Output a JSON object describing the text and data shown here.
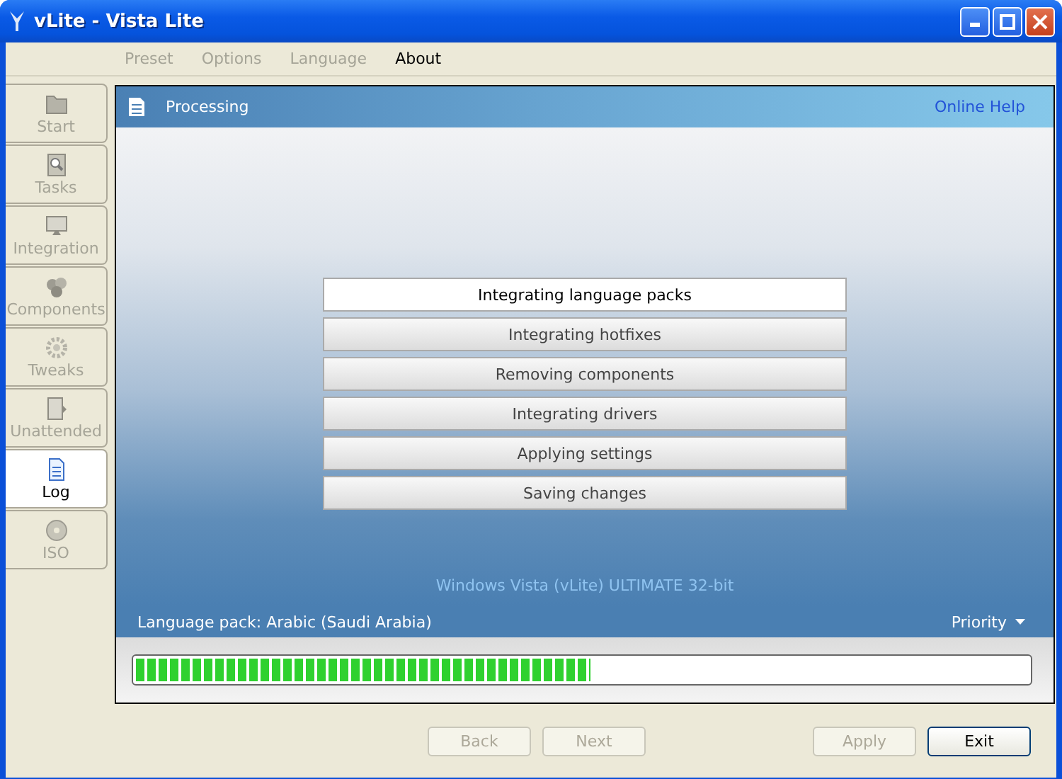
{
  "window": {
    "title": "vLite - Vista Lite"
  },
  "menu": [
    {
      "label": "Preset",
      "disabled": true
    },
    {
      "label": "Options",
      "disabled": true
    },
    {
      "label": "Language",
      "disabled": true
    },
    {
      "label": "About",
      "disabled": false
    }
  ],
  "sidebar": {
    "items": [
      {
        "label": "Start",
        "selected": false
      },
      {
        "label": "Tasks",
        "selected": false
      },
      {
        "label": "Integration",
        "selected": false
      },
      {
        "label": "Components",
        "selected": false
      },
      {
        "label": "Tweaks",
        "selected": false
      },
      {
        "label": "Unattended",
        "selected": false
      },
      {
        "label": "Log",
        "selected": true
      },
      {
        "label": "ISO",
        "selected": false
      }
    ]
  },
  "panel": {
    "title": "Processing",
    "help_link": "Online Help",
    "steps": [
      {
        "label": "Integrating language packs",
        "selected": true
      },
      {
        "label": "Integrating hotfixes",
        "selected": false
      },
      {
        "label": "Removing components",
        "selected": false
      },
      {
        "label": "Integrating drivers",
        "selected": false
      },
      {
        "label": "Applying settings",
        "selected": false
      },
      {
        "label": "Saving changes",
        "selected": false
      }
    ],
    "edition": "Windows Vista (vLite) ULTIMATE 32-bit",
    "status": "Language pack: Arabic (Saudi Arabia)",
    "priority": "Priority",
    "progress": {
      "level": 0.51
    }
  },
  "buttons": [
    {
      "label": "Back",
      "disabled": true
    },
    {
      "label": "Next",
      "disabled": true
    },
    {
      "label": "Apply",
      "disabled": true
    },
    {
      "label": "Exit",
      "disabled": false
    }
  ]
}
